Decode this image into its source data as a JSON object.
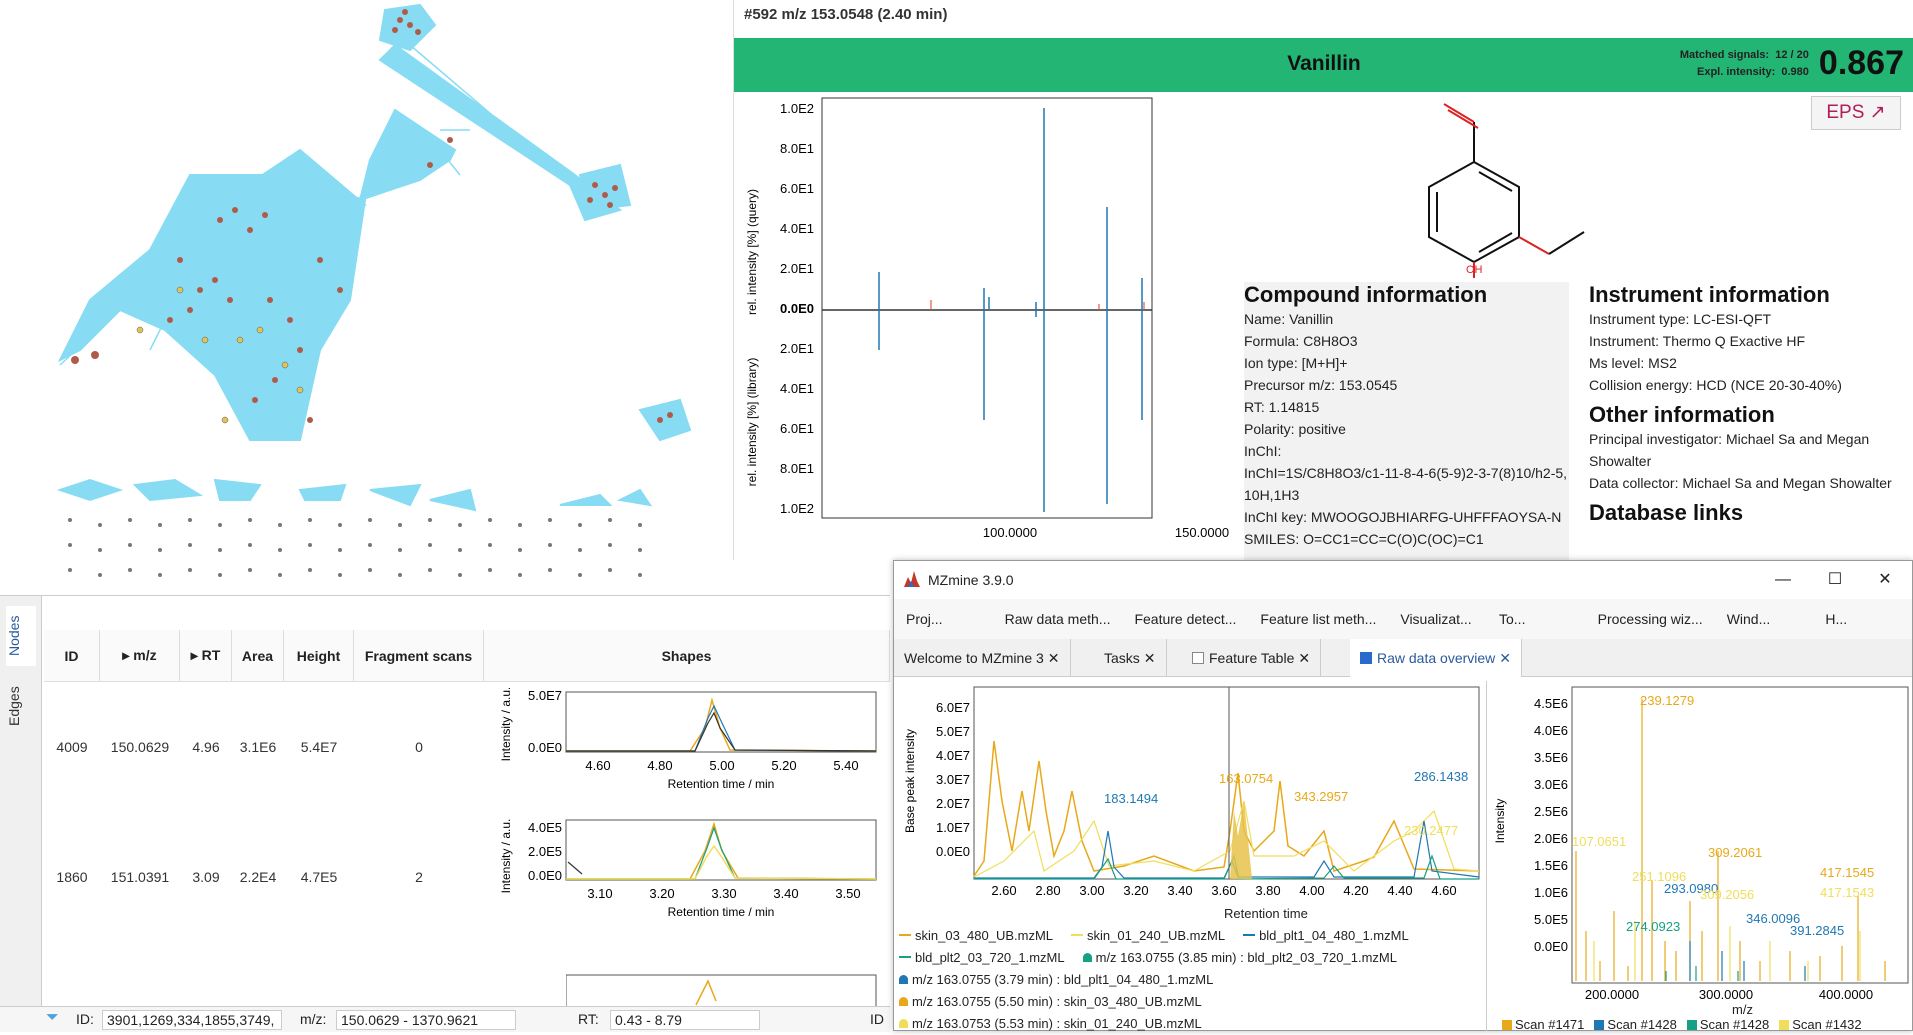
{
  "match": {
    "header": "#592 m/z 153.0548 (2.40 min)",
    "compound_name": "Vanillin",
    "matched_signals_label": "Matched signals:",
    "matched_signals_value": "12 / 20",
    "expl_intensity_label": "Expl. intensity:",
    "expl_intensity_value": "0.980",
    "score": "0.867",
    "eps_label": "EPS",
    "structure_atom_oh": "OH",
    "compound_info": {
      "title": "Compound information",
      "lines": [
        "Name: Vanillin",
        "Formula: C8H8O3",
        "Ion type: [M+H]+",
        "Precursor m/z: 153.0545",
        "RT: 1.14815",
        "Polarity: positive",
        "InChI:",
        "InChI=1S/C8H8O3/c1-11-8-4-6(5-9)2-3-7(8)10/h2-5,10H,1H3",
        "InChI key: MWOOGOJBHIARFG-UHFFFAOYSA-N",
        "SMILES: O=CC1=CC=C(O)C(OC)=C1"
      ]
    },
    "instrument_info": {
      "title": "Instrument information",
      "lines": [
        "Instrument type: LC-ESI-QFT",
        "Instrument: Thermo Q Exactive HF",
        "Ms level: MS2",
        "Collision energy: HCD (NCE 20-30-40%)"
      ]
    },
    "other_info": {
      "title": "Other information",
      "lines": [
        "Principal investigator: Michael Sa and Megan Showalter",
        "Data collector: Michael Sa and Megan Showalter"
      ]
    },
    "database_links_title": "Database links",
    "mirror_plot": {
      "ylabel_query": "rel. intensity [%] (query)",
      "ylabel_library": "rel. intensity [%] (library)",
      "yticks_top": [
        "1.0E2",
        "8.0E1",
        "6.0E1",
        "4.0E1",
        "2.0E1",
        "0.0E0"
      ],
      "yticks_bottom": [
        "2.0E1",
        "4.0E1",
        "6.0E1",
        "8.0E1",
        "1.0E2"
      ],
      "xticks": [
        "100.0000",
        "150.0000"
      ]
    }
  },
  "table": {
    "side_tabs": [
      "Nodes",
      "Edges"
    ],
    "headers": [
      "ID",
      "▸ m/z",
      "▸ RT",
      "Area",
      "Height",
      "Fragment scans",
      "Shapes"
    ],
    "rows": [
      {
        "id": "4009",
        "mz": "150.0629",
        "rt": "4.96",
        "area": "3.1E6",
        "height": "5.4E7",
        "frag": "0",
        "shape_yticks": [
          "5.0E7",
          "0.0E0"
        ],
        "shape_xticks": [
          "4.60",
          "4.80",
          "5.00",
          "5.20",
          "5.40"
        ]
      },
      {
        "id": "1860",
        "mz": "151.0391",
        "rt": "3.09",
        "area": "2.2E4",
        "height": "4.7E5",
        "frag": "2",
        "shape_yticks": [
          "4.0E5",
          "2.0E5",
          "0.0E0"
        ],
        "shape_xticks": [
          "3.10",
          "3.20",
          "3.30",
          "3.40",
          "3.50"
        ]
      }
    ],
    "shape_xlabel": "Retention time / min",
    "shape_ylabel": "Intensity / a.u.",
    "filter": {
      "id_label": "ID:",
      "id_value": "3901,1269,334,1855,3749,",
      "mz_label": "m/z:",
      "mz_value": "150.0629 - 1370.9621",
      "rt_label": "RT:",
      "rt_value": "0.43 - 8.79",
      "id2_label": "ID"
    }
  },
  "mzmine": {
    "title": "MZmine 3.9.0",
    "menu": [
      "Proj...",
      "Raw data meth...",
      "Feature detect...",
      "Feature list meth...",
      "Visualizat...",
      "To...",
      "Processing wiz...",
      "Wind...",
      "H..."
    ],
    "tabs": [
      "Welcome to MZmine 3",
      "Tasks",
      "Feature Table",
      "Raw data overview"
    ],
    "chrom": {
      "ylabel": "Base peak intensity",
      "xlabel": "Retention time",
      "yticks": [
        "6.0E7",
        "5.0E7",
        "4.0E7",
        "3.0E7",
        "2.0E7",
        "1.0E7",
        "0.0E0"
      ],
      "xticks": [
        "2.60",
        "2.80",
        "3.00",
        "3.20",
        "3.40",
        "3.60",
        "3.80",
        "4.00",
        "4.20",
        "4.40",
        "4.60"
      ],
      "peak_labels": [
        "183.1494",
        "163.0754",
        "343.2957",
        "286.1438",
        "230.2477"
      ]
    },
    "legend": [
      "skin_03_480_UB.mzML",
      "skin_01_240_UB.mzML",
      "bld_plt1_04_480_1.mzML",
      "bld_plt2_03_720_1.mzML",
      "m/z 163.0755 (3.85 min) : bld_plt2_03_720_1.mzML",
      "m/z 163.0755 (3.79 min) : bld_plt1_04_480_1.mzML",
      "m/z 163.0755 (5.50 min) : skin_03_480_UB.mzML",
      "m/z 163.0753 (5.53 min) : skin_01_240_UB.mzML"
    ],
    "spectrum": {
      "ylabel": "Intensity",
      "xlabel": "m/z",
      "yticks": [
        "4.5E6",
        "4.0E6",
        "3.5E6",
        "3.0E6",
        "2.5E6",
        "2.0E6",
        "1.5E6",
        "1.0E6",
        "5.0E5",
        "0.0E0"
      ],
      "xticks": [
        "200.0000",
        "300.0000",
        "400.0000"
      ],
      "peak_labels": [
        "239.1279",
        "107.0651",
        "309.2061",
        "251.1096",
        "293.0980",
        "309.2056",
        "417.1545",
        "417.1543",
        "346.0096",
        "274.0923",
        "391.2845"
      ],
      "scans": [
        "Scan #1471",
        "Scan #1428",
        "Scan #1428",
        "Scan #1432"
      ]
    }
  },
  "colors": {
    "match_green": "#22b573",
    "network_edge": "#87dcf4",
    "gold": "#e8a81a",
    "yellow": "#f0de5a",
    "blue": "#1f77b4",
    "teal": "#16a085"
  }
}
